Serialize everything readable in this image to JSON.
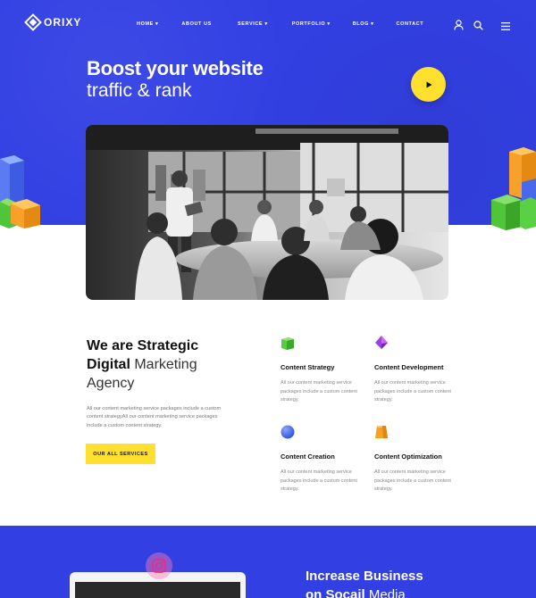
{
  "brand": {
    "name": "ORIXY"
  },
  "nav": {
    "items": [
      {
        "label": "HOME",
        "caret": "▾"
      },
      {
        "label": "ABOUT US",
        "caret": ""
      },
      {
        "label": "SERVICE",
        "caret": "▾"
      },
      {
        "label": "PORTFOLIO",
        "caret": "▾"
      },
      {
        "label": "BLOG",
        "caret": "▾"
      },
      {
        "label": "CONTACT",
        "caret": ""
      }
    ],
    "icons": [
      "user-icon",
      "search-icon",
      "hamburger-menu-icon"
    ]
  },
  "hero": {
    "title_line1": "Boost your website",
    "title_line2": "traffic & rank",
    "play_icon": "play-icon",
    "background_color": "#3240e3",
    "accent_color": "#ffe02e"
  },
  "about": {
    "title_bold_1": "We are Strategic",
    "title_bold_2": "Digital",
    "title_light_2": " Marketing",
    "title_light_3": "Agency",
    "description": "All our content marketing service packages include a custom content strategyAll our content marketing service packages include a custom content strategy.",
    "button_label": "OUR ALL SERVICES"
  },
  "services": [
    {
      "name": "Content Strategy",
      "icon": "green-cube-icon",
      "description": "All our content marketing service packages include a custom content strategy."
    },
    {
      "name": "Content Development",
      "icon": "purple-pyramid-icon",
      "description": "All our content marketing service packages include a custom content strategy."
    },
    {
      "name": "Content Creation",
      "icon": "blue-sphere-icon",
      "description": "All our content marketing service packages include a custom content strategy."
    },
    {
      "name": "Content Optimization",
      "icon": "orange-cone-icon",
      "description": "All our content marketing service packages include a custom content strategy."
    }
  ],
  "social": {
    "title_bold_1": "Increase Business",
    "title_bold_2": "on Socail",
    "title_light_2": " Media",
    "badge_icon": "instagram-icon"
  }
}
